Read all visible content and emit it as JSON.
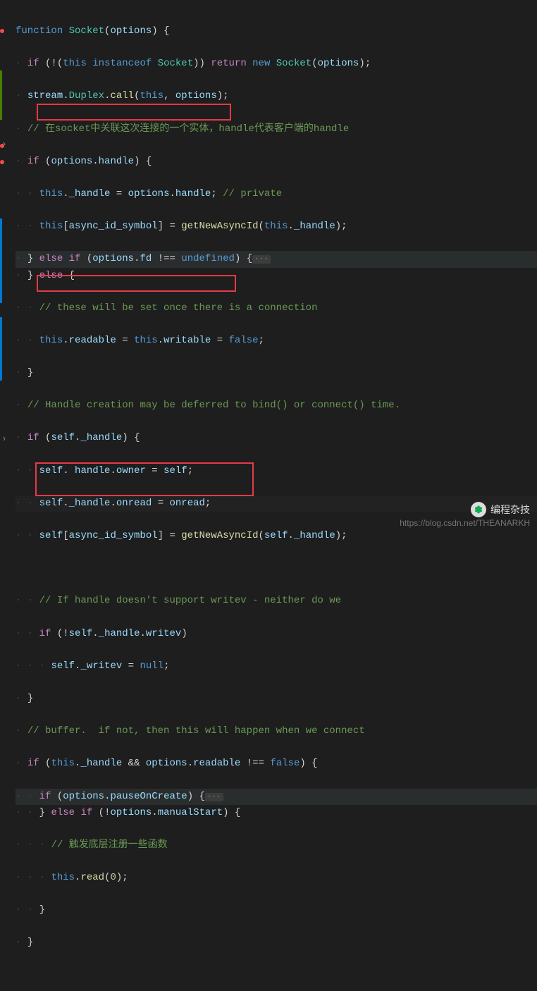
{
  "code": {
    "l1_function": "function",
    "l1_socket": "Socket",
    "l1_options": "options",
    "l2_if": "if",
    "l2_this": "this",
    "l2_instanceof": "instanceof",
    "l2_socket": "Socket",
    "l2_return": "return",
    "l2_new": "new",
    "l2_options": "options",
    "l3_stream": "stream",
    "l3_duplex": "Duplex",
    "l3_call": "call",
    "l3_this": "this",
    "l3_options": "options",
    "l4_comment": "// 在socket中关联这次连接的一个实体，handle代表客户端的handle",
    "l5_if": "if",
    "l5_options": "options",
    "l5_handle": "handle",
    "l6_this": "this",
    "l6_handle": "_handle",
    "l6_options": "options",
    "l6_handle2": "handle",
    "l6_comment": "// private",
    "l7_this": "this",
    "l7_sym": "async_id_symbol",
    "l7_fn": "getNewAsyncId",
    "l7_this2": "this",
    "l7_handle": "_handle",
    "l8_else": "else",
    "l8_if": "if",
    "l8_options": "options",
    "l8_fd": "fd",
    "l8_undefined": "undefined",
    "l9_else": "else",
    "l10_comment": "// these will be set once there is a connection",
    "l11_this": "this",
    "l11_readable": "readable",
    "l11_this2": "this",
    "l11_writable": "writable",
    "l11_false": "false",
    "l13_comment": "// Handle creation may be deferred to bind() or connect() time.",
    "l14_if": "if",
    "l14_self": "self",
    "l14_handle": "_handle",
    "l15_self": "self",
    "l15_handle": " handle",
    "l15_owner": "owner",
    "l15_self2": "self",
    "l16_self": "self",
    "l16_handle": "_handle",
    "l16_onread": "onread",
    "l16_onread2": "onread",
    "l17_self": "self",
    "l17_sym": "async_id_symbol",
    "l17_fn": "getNewAsyncId",
    "l17_self2": "self",
    "l17_handle": "_handle",
    "l19_comment": "// If handle doesn't support writev - neither do we",
    "l20_if": "if",
    "l20_self": "self",
    "l20_handle": "_handle",
    "l20_writev": "writev",
    "l21_self": "self",
    "l21_writev": "_writev",
    "l21_null": "null",
    "l23_comment": "// buffer.  if not, then this will happen when we connect",
    "l24_if": "if",
    "l24_this": "this",
    "l24_handle": "_handle",
    "l24_options": "options",
    "l24_readable": "readable",
    "l24_false": "false",
    "l25_if": "if",
    "l25_options": "options",
    "l25_pause": "pauseOnCreate",
    "l26_else": "else",
    "l26_if": "if",
    "l26_options": "options",
    "l26_manual": "manualStart",
    "l27_comment": "// 触发底层注册一些函数",
    "l28_this": "this",
    "l28_read": "read",
    "l28_zero": "0",
    "fold": "···"
  },
  "watermark": {
    "text": "编程杂技",
    "url": "https://blog.csdn.net/THEANARKH"
  }
}
